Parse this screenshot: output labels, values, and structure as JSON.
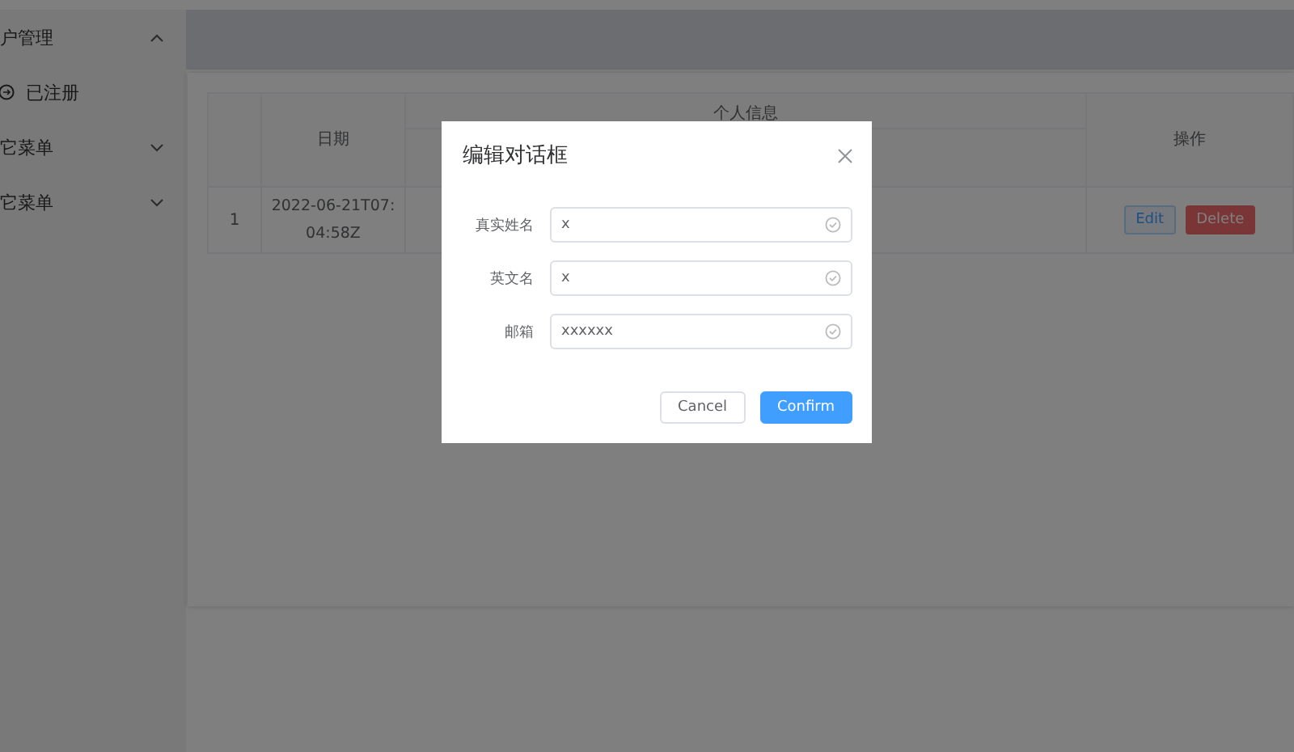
{
  "sidebar": {
    "items": [
      {
        "label": "户管理",
        "expanded": true,
        "children": [
          {
            "label": "已注册"
          }
        ]
      },
      {
        "label": "它菜单",
        "expanded": false
      },
      {
        "label": "它菜单",
        "expanded": false
      }
    ]
  },
  "table": {
    "columns": [
      {
        "label": "日期"
      },
      {
        "label": "个人信息"
      },
      {
        "label": "操作"
      }
    ],
    "rows": [
      {
        "index": "1",
        "date": "2022-06-21T07:04:58Z",
        "actions": [
          {
            "label": "Edit",
            "kind": "edit"
          },
          {
            "label": "Delete",
            "kind": "delete"
          }
        ]
      }
    ]
  },
  "dialog": {
    "title": "编辑对话框",
    "fields": [
      {
        "label": "真实姓名",
        "value": "x"
      },
      {
        "label": "英文名",
        "value": "x"
      },
      {
        "label": "邮箱",
        "value": "xxxxxx"
      }
    ],
    "buttons": [
      {
        "label": "Cancel",
        "kind": "default"
      },
      {
        "label": "Confirm",
        "kind": "primary"
      }
    ]
  }
}
